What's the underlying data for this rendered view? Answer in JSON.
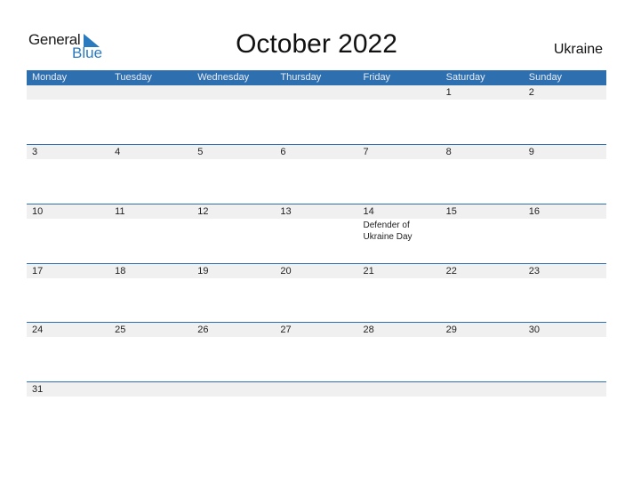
{
  "logo": {
    "text_general": "General",
    "text_blue": "Blue"
  },
  "title": "October 2022",
  "country": "Ukraine",
  "colors": {
    "header_bg": "#2e6fb0",
    "strip_bg": "#f0f0f0",
    "logo_blue": "#2a7ac0"
  },
  "weekdays": [
    "Monday",
    "Tuesday",
    "Wednesday",
    "Thursday",
    "Friday",
    "Saturday",
    "Sunday"
  ],
  "weeks": [
    {
      "days": [
        {
          "num": "",
          "holiday": ""
        },
        {
          "num": "",
          "holiday": ""
        },
        {
          "num": "",
          "holiday": ""
        },
        {
          "num": "",
          "holiday": ""
        },
        {
          "num": "",
          "holiday": ""
        },
        {
          "num": "1",
          "holiday": ""
        },
        {
          "num": "2",
          "holiday": ""
        }
      ]
    },
    {
      "days": [
        {
          "num": "3",
          "holiday": ""
        },
        {
          "num": "4",
          "holiday": ""
        },
        {
          "num": "5",
          "holiday": ""
        },
        {
          "num": "6",
          "holiday": ""
        },
        {
          "num": "7",
          "holiday": ""
        },
        {
          "num": "8",
          "holiday": ""
        },
        {
          "num": "9",
          "holiday": ""
        }
      ]
    },
    {
      "days": [
        {
          "num": "10",
          "holiday": ""
        },
        {
          "num": "11",
          "holiday": ""
        },
        {
          "num": "12",
          "holiday": ""
        },
        {
          "num": "13",
          "holiday": ""
        },
        {
          "num": "14",
          "holiday": "Defender of Ukraine Day"
        },
        {
          "num": "15",
          "holiday": ""
        },
        {
          "num": "16",
          "holiday": ""
        }
      ]
    },
    {
      "days": [
        {
          "num": "17",
          "holiday": ""
        },
        {
          "num": "18",
          "holiday": ""
        },
        {
          "num": "19",
          "holiday": ""
        },
        {
          "num": "20",
          "holiday": ""
        },
        {
          "num": "21",
          "holiday": ""
        },
        {
          "num": "22",
          "holiday": ""
        },
        {
          "num": "23",
          "holiday": ""
        }
      ]
    },
    {
      "days": [
        {
          "num": "24",
          "holiday": ""
        },
        {
          "num": "25",
          "holiday": ""
        },
        {
          "num": "26",
          "holiday": ""
        },
        {
          "num": "27",
          "holiday": ""
        },
        {
          "num": "28",
          "holiday": ""
        },
        {
          "num": "29",
          "holiday": ""
        },
        {
          "num": "30",
          "holiday": ""
        }
      ]
    },
    {
      "days": [
        {
          "num": "31",
          "holiday": ""
        },
        {
          "num": "",
          "holiday": ""
        },
        {
          "num": "",
          "holiday": ""
        },
        {
          "num": "",
          "holiday": ""
        },
        {
          "num": "",
          "holiday": ""
        },
        {
          "num": "",
          "holiday": ""
        },
        {
          "num": "",
          "holiday": ""
        }
      ]
    }
  ]
}
